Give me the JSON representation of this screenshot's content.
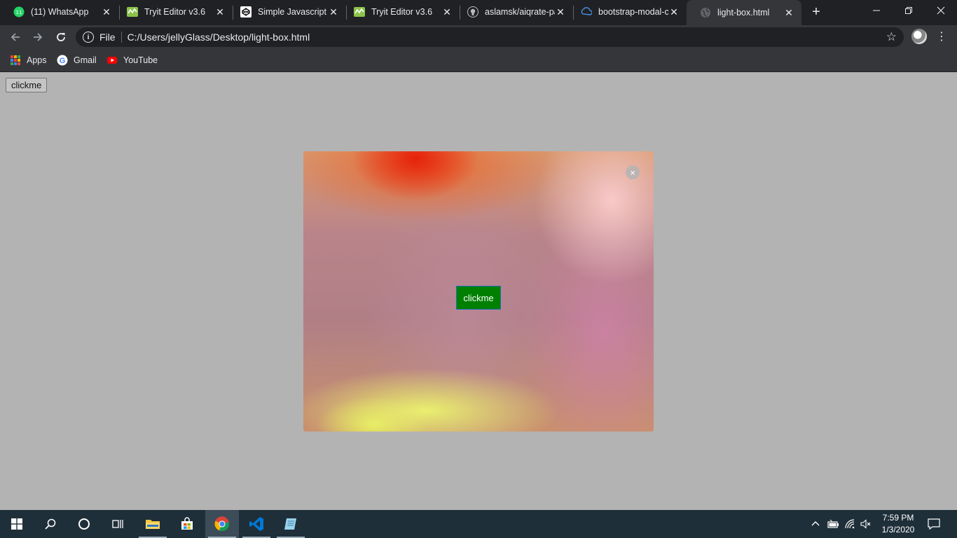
{
  "browser": {
    "tabs": [
      {
        "title": "(11) WhatsApp",
        "icon": "whatsapp-icon",
        "active": false
      },
      {
        "title": "Tryit Editor v3.6",
        "icon": "w3schools-icon",
        "active": false
      },
      {
        "title": "Simple Javascript L",
        "icon": "codepen-icon",
        "active": false
      },
      {
        "title": "Tryit Editor v3.6",
        "icon": "w3schools-icon",
        "active": false
      },
      {
        "title": "aslamsk/aiqrate-pa",
        "icon": "github-icon",
        "active": false
      },
      {
        "title": "bootstrap-modal-c",
        "icon": "codesandbox-icon",
        "active": false
      },
      {
        "title": "light-box.html",
        "icon": "globe-icon",
        "active": true
      }
    ],
    "address": {
      "scheme_label": "File",
      "url": "C:/Users/jellyGlass/Desktop/light-box.html"
    },
    "bookmarks": [
      {
        "label": "Apps",
        "icon": "apps-grid-icon"
      },
      {
        "label": "Gmail",
        "icon": "google-icon"
      },
      {
        "label": "YouTube",
        "icon": "youtube-icon"
      }
    ]
  },
  "page": {
    "open_button_label": "clickme",
    "lightbox": {
      "close_symbol": "×",
      "button_label": "clickme",
      "button_color": "#008000"
    }
  },
  "taskbar": {
    "apps": [
      "start-icon",
      "search-icon",
      "cortana-icon",
      "task-view-icon",
      "file-explorer-icon",
      "store-icon",
      "chrome-icon",
      "vscode-icon",
      "notepad-icon"
    ],
    "clock": {
      "time": "7:59 PM",
      "date": "1/3/2020"
    }
  },
  "colors": {
    "tabstrip_bg": "#202124",
    "toolbar_bg": "#35363a",
    "page_overlay": "#b3b3b3",
    "taskbar_bg": "#1f2f3a"
  }
}
